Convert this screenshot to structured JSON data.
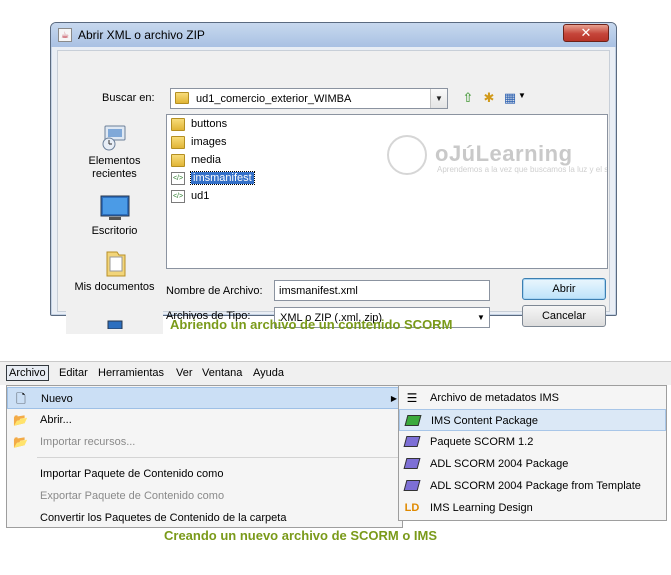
{
  "dialog": {
    "title": "Abrir XML o archivo ZIP",
    "close_glyph": "✕",
    "look_in_label": "Buscar en:",
    "look_in_value": "ud1_comercio_exterior_WIMBA",
    "places": [
      {
        "label": "Elementos recientes"
      },
      {
        "label": "Escritorio"
      },
      {
        "label": "Mis documentos"
      },
      {
        "label": ""
      }
    ],
    "files": [
      {
        "name": "buttons",
        "type": "folder"
      },
      {
        "name": "images",
        "type": "folder"
      },
      {
        "name": "media",
        "type": "folder"
      },
      {
        "name": "imsmanifest",
        "type": "xml",
        "selected": true
      },
      {
        "name": "ud1",
        "type": "xml"
      }
    ],
    "watermark_title": "oJúLearning",
    "watermark_subtitle": "Aprendemos a la vez que buscamos la luz y el saber en red",
    "file_name_label": "Nombre de Archivo:",
    "file_name_value": "imsmanifest.xml",
    "file_type_label": "Archivos de Tipo:",
    "file_type_value": "XML o ZIP (.xml, zip)",
    "open_label": "Abrir",
    "cancel_label": "Cancelar"
  },
  "caption_1": "Abriendo un archivo de un contenido SCORM",
  "menubar": {
    "items": [
      "Archivo",
      "Editar",
      "Herramientas",
      "Ver",
      "Ventana",
      "Ayuda"
    ]
  },
  "file_menu": {
    "nuevo": "Nuevo",
    "abrir": "Abrir...",
    "importar_recursos": "Importar recursos...",
    "importar_paquete": "Importar Paquete de Contenido como",
    "exportar_paquete": "Exportar Paquete de Contenido como",
    "convertir": "Convertir los Paquetes de Contenido de la carpeta"
  },
  "submenu": {
    "metadatos": "Archivo de metadatos IMS",
    "ims_cp": "IMS Content Package",
    "scorm12": "Paquete SCORM 1.2",
    "adl2004": "ADL SCORM 2004 Package",
    "adl2004_template": "ADL SCORM 2004 Package from Template",
    "ld": "IMS Learning Design",
    "ld_icon_text": "LD"
  },
  "caption_2": "Creando un nuevo archivo de SCORM o IMS",
  "colors": {
    "caption": "#7a9a1a",
    "selection": "#3470c8",
    "close_button": "#c5453a"
  }
}
